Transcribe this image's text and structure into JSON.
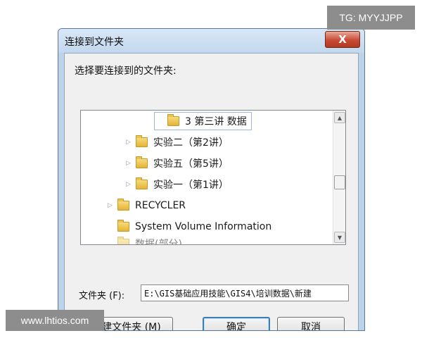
{
  "dialog": {
    "title": "连接到文件夹",
    "close_label": "X",
    "prompt": "选择要连接到的文件夹:",
    "tree": {
      "items": [
        {
          "label": "3 第三讲 数据",
          "icon": "folder-icon",
          "expander": "",
          "selected": true
        },
        {
          "label": "实验二（第2讲）",
          "icon": "folder-icon",
          "expander": "▷"
        },
        {
          "label": "实验五（第5讲）",
          "icon": "folder-icon",
          "expander": "▷"
        },
        {
          "label": "实验一（第1讲）",
          "icon": "folder-icon",
          "expander": "▷"
        },
        {
          "label": "RECYCLER",
          "icon": "folder-icon",
          "expander": "▷"
        },
        {
          "label": "System Volume Information",
          "icon": "folder-icon",
          "expander": ""
        },
        {
          "label": "数据(部分)",
          "icon": "folder-icon",
          "expander": ""
        }
      ],
      "scroll_up": "▲",
      "scroll_down": "▼"
    },
    "folder_label": "文件夹 (F):",
    "folder_value": "E:\\GIS基础应用技能\\GIS4\\培训数据\\新建",
    "buttons": {
      "new_folder": "新建文件夹 (M)",
      "ok": "确定",
      "cancel": "取消"
    }
  },
  "watermarks": {
    "tg": "TG: MYYJJPP",
    "site": "www.lhtios.com"
  },
  "colors": {
    "frame": "#bdd3e9",
    "close_button": "#c94a35",
    "default_button_border": "#3c7fb1",
    "folder": "#e3b438"
  }
}
